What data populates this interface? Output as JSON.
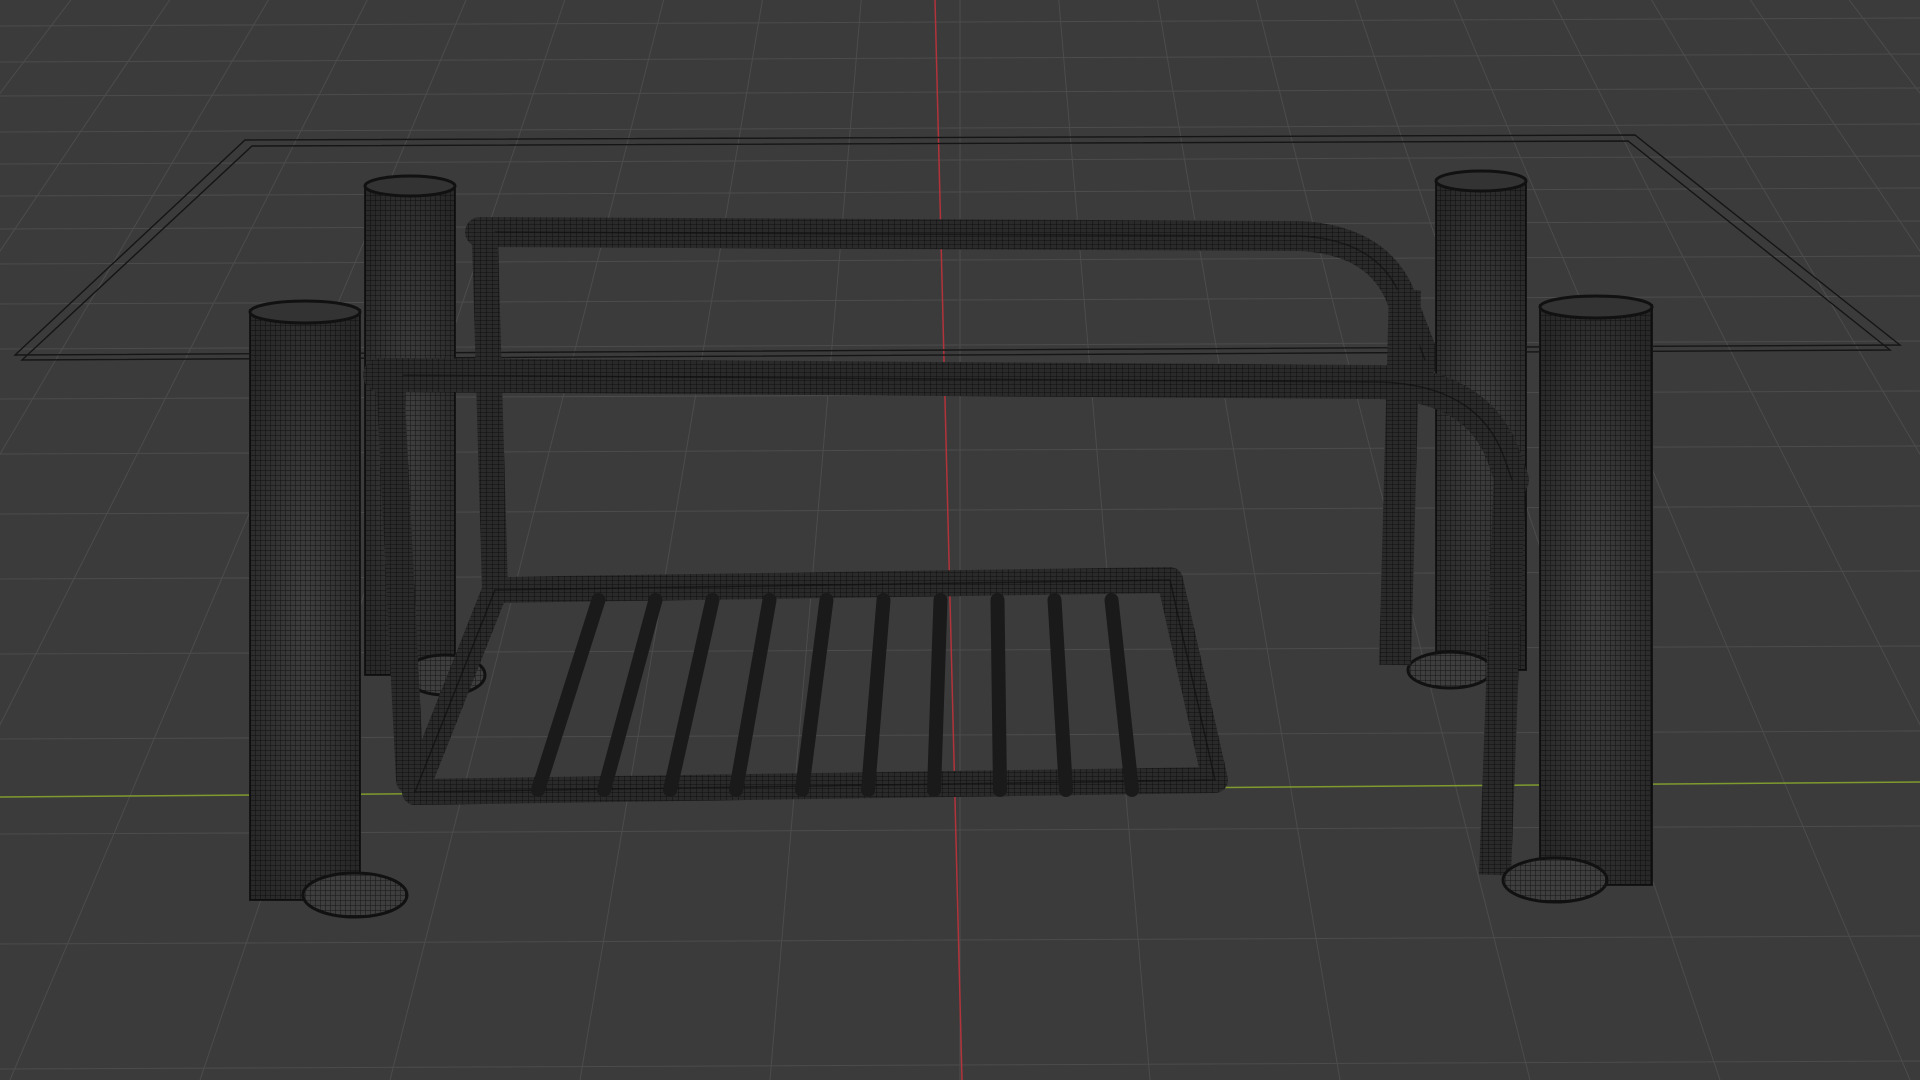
{
  "viewport": {
    "view": "perspective",
    "shading": "wireframe",
    "background_color": "#3b3b3b",
    "grid_color": "#4c4c4c",
    "axis_x_color": "#7f9a2e",
    "axis_y_color": "#b2333b",
    "wire_color": "#141414"
  },
  "scene": {
    "objects": [
      {
        "name": "table-top-glass",
        "type": "plane",
        "display": "wire"
      },
      {
        "name": "leg-front-left",
        "type": "cylinder",
        "display": "wire"
      },
      {
        "name": "leg-back-left",
        "type": "cylinder",
        "display": "wire"
      },
      {
        "name": "leg-back-right",
        "type": "cylinder",
        "display": "wire"
      },
      {
        "name": "leg-front-right",
        "type": "cylinder",
        "display": "wire"
      },
      {
        "name": "frame-tube-back",
        "type": "tube",
        "display": "wire"
      },
      {
        "name": "frame-tube-front",
        "type": "tube",
        "display": "wire"
      },
      {
        "name": "shelf-rack",
        "type": "tube-array",
        "display": "wire",
        "bar_count": 10
      }
    ]
  }
}
